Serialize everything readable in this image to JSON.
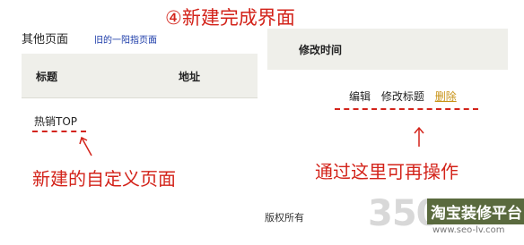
{
  "step_title": "④新建完成界面",
  "section_title": "其他页面",
  "old_link": "旧的一阳指页面",
  "left_table": {
    "col_title": "标题",
    "col_address": "地址"
  },
  "right_table": {
    "col_modified": "修改时间"
  },
  "row": {
    "page_name": "热销TOP"
  },
  "actions": {
    "edit": "编辑",
    "edit_title": "修改标题",
    "delete": "删除"
  },
  "annotations": {
    "left": "新建的自定义页面",
    "right": "通过这里可再操作"
  },
  "copyright": "版权所有",
  "watermark": {
    "number": "350",
    "brand": "淘宝装修平台",
    "site": "www.seo-lv.com"
  },
  "colors": {
    "annotation": "#d3231a",
    "link": "#1a3aa8",
    "delete": "#c89317",
    "header_bg": "#efefea"
  }
}
